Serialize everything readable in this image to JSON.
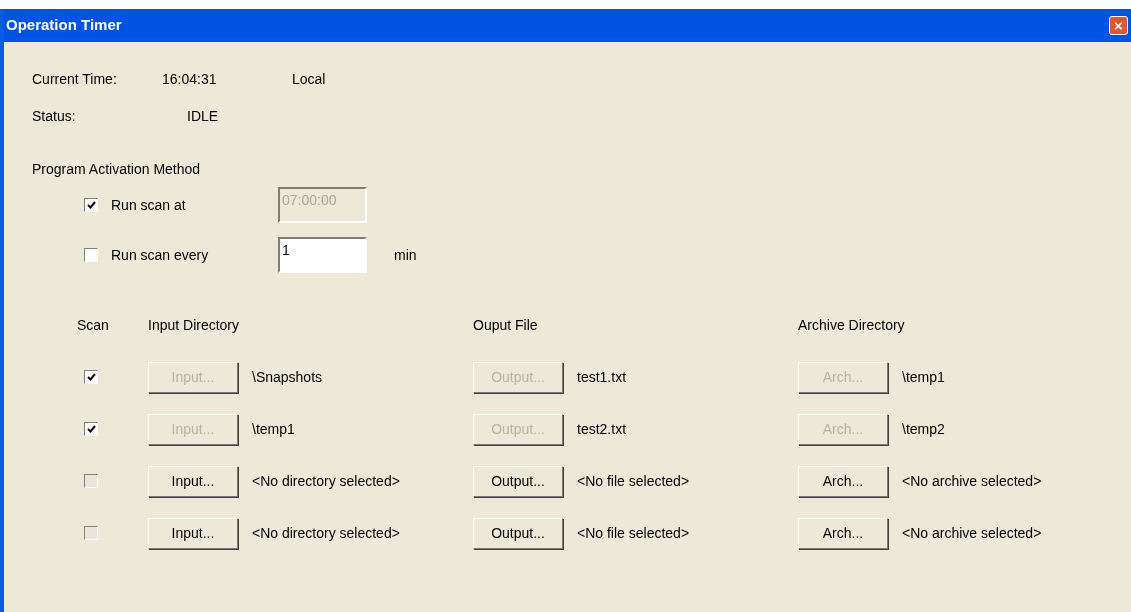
{
  "window": {
    "title": "Operation Timer",
    "close": "×"
  },
  "current_time": {
    "label": "Current Time:",
    "value": "16:04:31",
    "zone": "Local"
  },
  "status": {
    "label": "Status:",
    "value": "IDLE"
  },
  "activation": {
    "heading": "Program Activation Method",
    "options": [
      {
        "label": "Run scan at",
        "checked": true,
        "value": "07:00:00",
        "disabled": true
      },
      {
        "label": "Run scan every",
        "checked": false,
        "value": "1",
        "disabled": false,
        "unit": "min"
      }
    ]
  },
  "table": {
    "columns": [
      "Scan",
      "Input Directory",
      "Ouput File",
      "Archive Directory"
    ],
    "rows": [
      {
        "cells": [
          {
            "kind": "checkbox",
            "checked": true,
            "disabled": false
          },
          {
            "kind": "browse",
            "button": "Input...",
            "disabled": true,
            "text": "\\Snapshots"
          },
          {
            "kind": "browse",
            "button": "Output...",
            "disabled": true,
            "text": "test1.txt"
          },
          {
            "kind": "browse",
            "button": "Arch...",
            "disabled": true,
            "text": "\\temp1"
          }
        ]
      },
      {
        "cells": [
          {
            "kind": "checkbox",
            "checked": true,
            "disabled": false
          },
          {
            "kind": "browse",
            "button": "Input...",
            "disabled": true,
            "text": "\\temp1"
          },
          {
            "kind": "browse",
            "button": "Output...",
            "disabled": true,
            "text": "test2.txt"
          },
          {
            "kind": "browse",
            "button": "Arch...",
            "disabled": true,
            "text": "\\temp2"
          }
        ]
      },
      {
        "cells": [
          {
            "kind": "checkbox",
            "checked": false,
            "disabled": true
          },
          {
            "kind": "browse",
            "button": "Input...",
            "disabled": false,
            "text": "<No directory selected>"
          },
          {
            "kind": "browse",
            "button": "Output...",
            "disabled": false,
            "text": "<No file selected>"
          },
          {
            "kind": "browse",
            "button": "Arch...",
            "disabled": false,
            "text": "<No archive selected>"
          }
        ]
      },
      {
        "cells": [
          {
            "kind": "checkbox",
            "checked": false,
            "disabled": true
          },
          {
            "kind": "browse",
            "button": "Input...",
            "disabled": false,
            "text": "<No directory selected>"
          },
          {
            "kind": "browse",
            "button": "Output...",
            "disabled": false,
            "text": "<No file selected>"
          },
          {
            "kind": "browse",
            "button": "Arch...",
            "disabled": false,
            "text": "<No archive selected>"
          }
        ]
      }
    ]
  }
}
